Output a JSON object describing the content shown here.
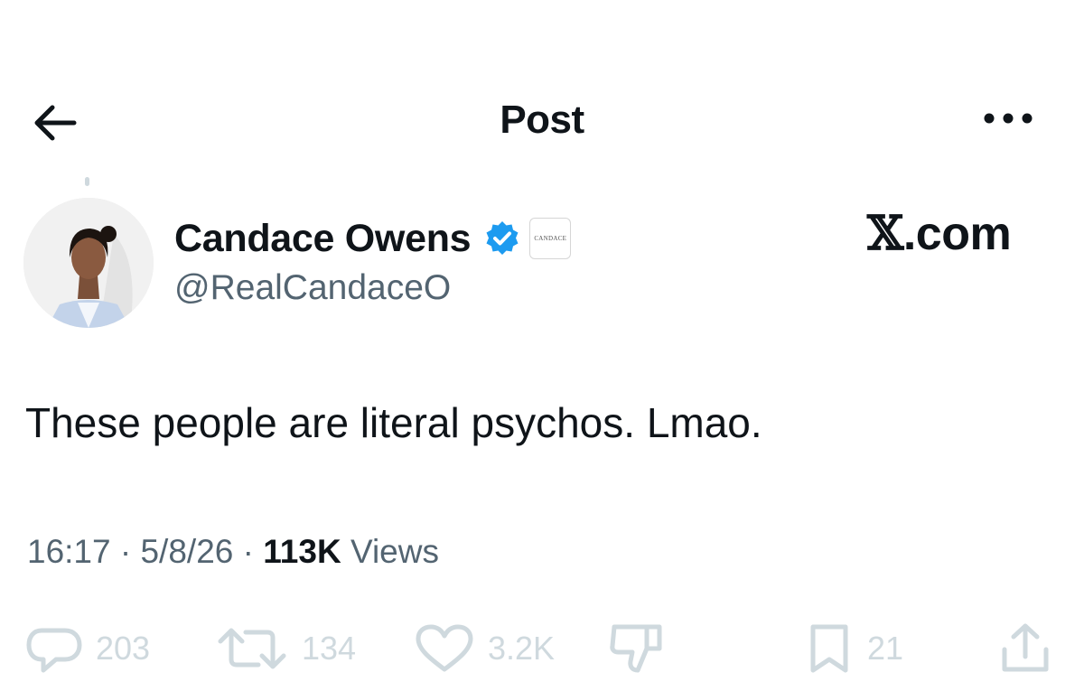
{
  "header": {
    "title": "Post"
  },
  "author": {
    "name": "Candace Owens",
    "handle": "@RealCandaceO",
    "affiliate_badge_text": "CANDACE"
  },
  "watermark": {
    "x": "𝕏",
    "domain": ".com"
  },
  "post": {
    "text": "These people are literal psychos. Lmao."
  },
  "meta": {
    "time": "16:17",
    "sep1": " · ",
    "date": "5/8/26",
    "sep2": " · ",
    "views": "113K",
    "views_label": " Views"
  },
  "actions": {
    "replies": "203",
    "reposts": "134",
    "likes": "3.2K",
    "bookmarks": "21"
  },
  "colors": {
    "text": "#0f1419",
    "secondary": "#536471",
    "verified": "#1d9bf0",
    "action_faded": "#cfd9de"
  },
  "icons": [
    "back-arrow-icon",
    "more-icon",
    "verified-badge-icon",
    "reply-icon",
    "repost-icon",
    "like-icon",
    "dislike-icon",
    "bookmark-icon",
    "share-icon"
  ]
}
